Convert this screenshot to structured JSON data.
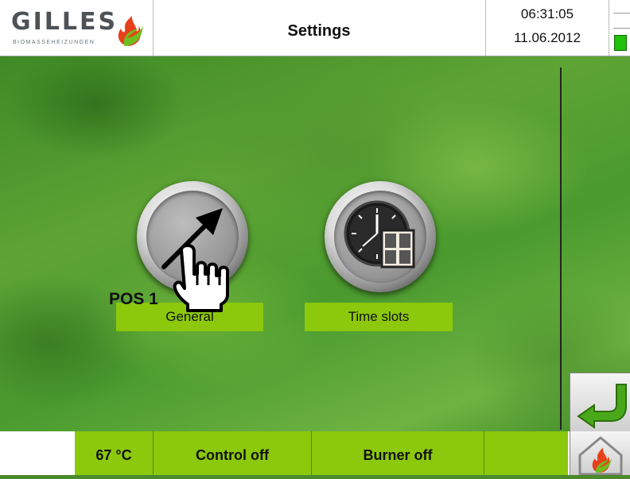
{
  "header": {
    "logo_text": "GILLES",
    "logo_subtitle": "BIOMASSEHEIZUNGEN",
    "title": "Settings",
    "time": "06:31:05",
    "date": "11.06.2012"
  },
  "main": {
    "buttons": [
      {
        "label": "General",
        "icon": "arrow-icon"
      },
      {
        "label": "Time slots",
        "icon": "clock-window-icon"
      }
    ],
    "pos_label": "POS 1",
    "cursor_icon": "hand-pointer-icon",
    "back_icon": "back-arrow-icon"
  },
  "footer": {
    "temperature": "67 °C",
    "control_status": "Control off",
    "burner_status": "Burner off",
    "home_icon": "home-flame-icon"
  },
  "colors": {
    "accent_green": "#8cc80c",
    "status_led": "#22c10a",
    "logo_gray": "#4d5257"
  }
}
